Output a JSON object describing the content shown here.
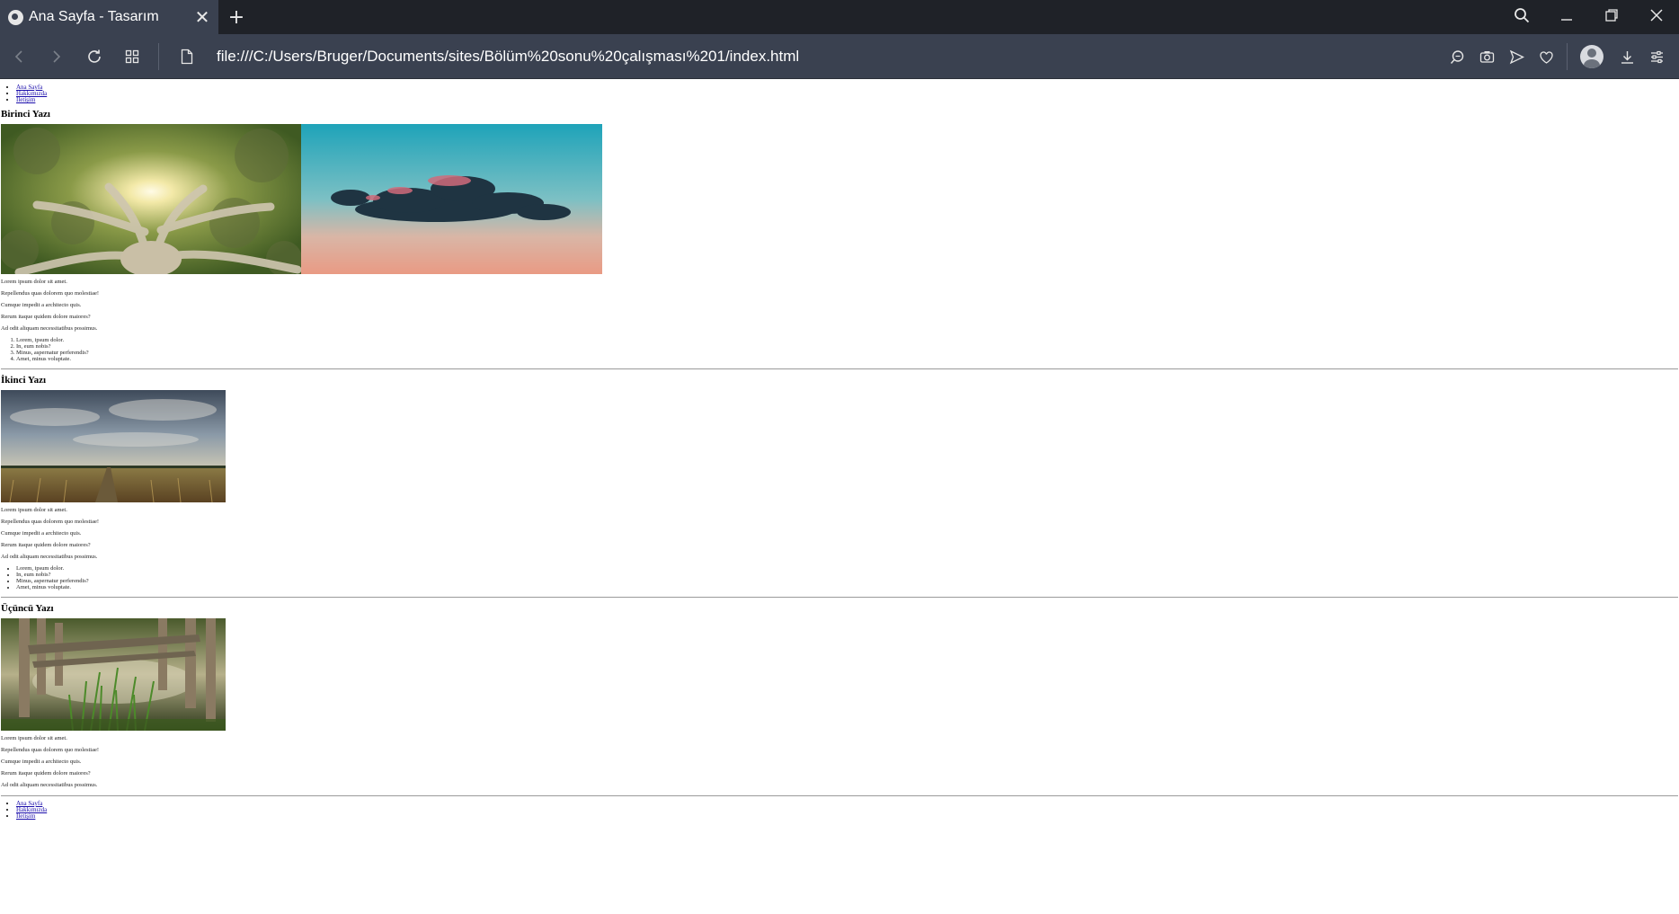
{
  "browser": {
    "tab_title": "Ana Sayfa - Tasarım",
    "url": "file:///C:/Users/Bruger/Documents/sites/Bölüm%20sonu%20çalışması%201/index.html"
  },
  "nav": {
    "items": [
      "Ana Sayfa",
      "Hakkımızda",
      "İletişim"
    ]
  },
  "posts": [
    {
      "title": "Birinci Yazı",
      "paragraphs": [
        "Lorem ipsum dolor sit amet.",
        "Repellendus quas dolorem quo molestiae!",
        "Cumque impedit a architecto quis.",
        "Rerum itaque quidem dolore maiores?",
        "Ad odit aliquam necessitatibus possimus."
      ],
      "list": [
        "Lorem, ipsum dolor.",
        "In, eum nobis?",
        "Minus, aspernatur perferendis?",
        "Amet, minus voluptate."
      ]
    },
    {
      "title": "İkinci Yazı",
      "paragraphs": [
        "Lorem ipsum dolor sit amet.",
        "Repellendus quas dolorem quo molestiae!",
        "Cumque impedit a architecto quis.",
        "Rerum itaque quidem dolore maiores?",
        "Ad odit aliquam necessitatibus possimus."
      ],
      "list": [
        "Lorem, ipsum dolor.",
        "In, eum nobis?",
        "Minus, aspernatur perferendis?",
        "Amet, minus voluptate."
      ]
    },
    {
      "title": "Üçüncü Yazı",
      "paragraphs": [
        "Lorem ipsum dolor sit amet.",
        "Repellendus quas dolorem quo molestiae!",
        "Cumque impedit a architecto quis.",
        "Rerum itaque quidem dolore maiores?",
        "Ad odit aliquam necessitatibus possimus."
      ]
    }
  ],
  "icons": {
    "back": "back-arrow-icon",
    "forward": "forward-arrow-icon",
    "reload": "reload-icon",
    "tabs": "tab-grid-icon",
    "page": "page-file-icon",
    "search": "search-icon",
    "camera": "camera-icon",
    "send": "send-icon",
    "heart": "heart-icon",
    "download": "download-icon",
    "settings": "settings-sliders-icon"
  }
}
